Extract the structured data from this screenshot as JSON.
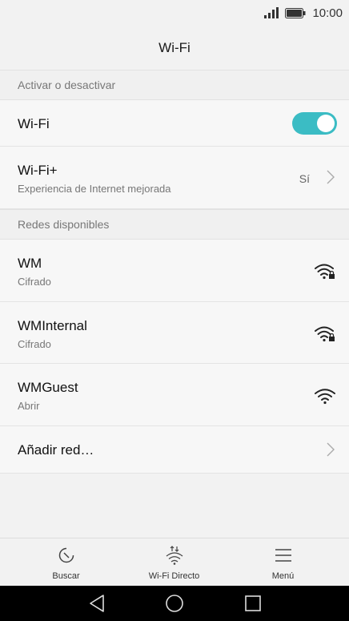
{
  "status_bar": {
    "time": "10:00",
    "icons": [
      "signal-icon",
      "battery-icon"
    ]
  },
  "header": {
    "title": "Wi-Fi"
  },
  "section_toggle": {
    "label": "Activar o desactivar"
  },
  "wifi_toggle": {
    "label": "Wi-Fi",
    "state": "on"
  },
  "wifi_plus": {
    "label": "Wi-Fi+",
    "subtitle": "Experiencia de Internet mejorada",
    "value": "Sí"
  },
  "section_networks": {
    "label": "Redes disponibles"
  },
  "networks": [
    {
      "name": "WM",
      "security": "Cifrado",
      "icon": "wifi-locked-icon"
    },
    {
      "name": "WMInternal",
      "security": "Cifrado",
      "icon": "wifi-locked-icon"
    },
    {
      "name": "WMGuest",
      "security": "Abrir",
      "icon": "wifi-icon"
    }
  ],
  "add_network": {
    "label": "Añadir red…"
  },
  "bottom_nav": [
    {
      "label": "Buscar",
      "icon": "refresh-icon"
    },
    {
      "label": "Wi-Fi Directo",
      "icon": "wifi-direct-icon"
    },
    {
      "label": "Menú",
      "icon": "menu-icon"
    }
  ],
  "colors": {
    "accent": "#3bbcc4",
    "background": "#f2f2f2"
  }
}
